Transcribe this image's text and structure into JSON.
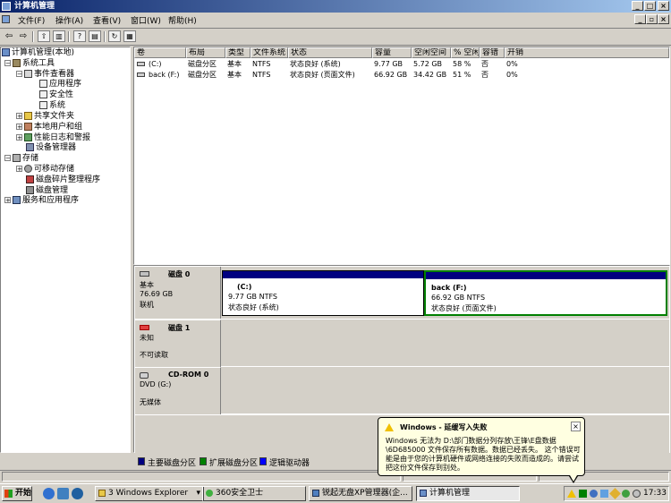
{
  "window": {
    "title": "计算机管理"
  },
  "menu": [
    "文件(F)",
    "操作(A)",
    "查看(V)",
    "窗口(W)",
    "帮助(H)"
  ],
  "tree": {
    "root": "计算机管理(本地)",
    "system_tools": "系统工具",
    "event_viewer": "事件查看器",
    "application": "应用程序",
    "security": "安全性",
    "system": "系统",
    "shared_folders": "共享文件夹",
    "local_users": "本地用户和组",
    "perf_logs": "性能日志和警报",
    "device_manager": "设备管理器",
    "storage": "存储",
    "removable_storage": "可移动存储",
    "defrag": "磁盘碎片整理程序",
    "disk_management": "磁盘管理",
    "services_apps": "服务和应用程序"
  },
  "volume_table": {
    "headers": [
      "卷",
      "布局",
      "类型",
      "文件系统",
      "状态",
      "容量",
      "空闲空间",
      "% 空闲",
      "容错",
      "开销"
    ],
    "rows": [
      [
        "(C:)",
        "磁盘分区",
        "基本",
        "NTFS",
        "状态良好 (系统)",
        "9.77 GB",
        "5.72 GB",
        "58 %",
        "否",
        "0%"
      ],
      [
        "back (F:)",
        "磁盘分区",
        "基本",
        "NTFS",
        "状态良好 (页面文件)",
        "66.92 GB",
        "34.42 GB",
        "51 %",
        "否",
        "0%"
      ]
    ]
  },
  "disks": {
    "disk0": {
      "name": "磁盘 0",
      "type": "基本",
      "size": "76.69 GB",
      "status": "联机",
      "partitions": [
        {
          "label": "(C:)",
          "info": "9.77 GB NTFS",
          "status": "状态良好 (系统)"
        },
        {
          "label": "back  (F:)",
          "info": "66.92 GB NTFS",
          "status": "状态良好 (页面文件)"
        }
      ]
    },
    "disk1": {
      "name": "磁盘 1",
      "type": "未知",
      "status": "不可读取"
    },
    "cdrom0": {
      "name": "CD-ROM 0",
      "type": "DVD (G:)",
      "status": "无媒体"
    }
  },
  "legend": [
    {
      "label": "主要磁盘分区",
      "color": "#000080"
    },
    {
      "label": "扩展磁盘分区",
      "color": "#008000"
    },
    {
      "label": "逻辑驱动器",
      "color": "#0000ff"
    }
  ],
  "balloon": {
    "title": "Windows - 延缓写入失败",
    "body": "Windows 无法为 D:\\部门数据分列存放\\王锋\\E盘数据\\6D685000 文件保存所有数据。数据已经丢失。 这个错误可能是由于您的计算机硬件或网络连接的失败而造成的。请尝试把这份文件保存到别处。"
  },
  "taskbar": {
    "start": "开始",
    "tasks": [
      "3 Windows Explorer",
      "360安全卫士",
      "锐起无盘XP管理器(企...",
      "计算机管理"
    ],
    "clock": "17:33"
  },
  "colors": {
    "primary_partition": "#000080",
    "extended_partition": "#008000",
    "logical_drive": "#0000ff",
    "title_bar": "#0a246a"
  }
}
